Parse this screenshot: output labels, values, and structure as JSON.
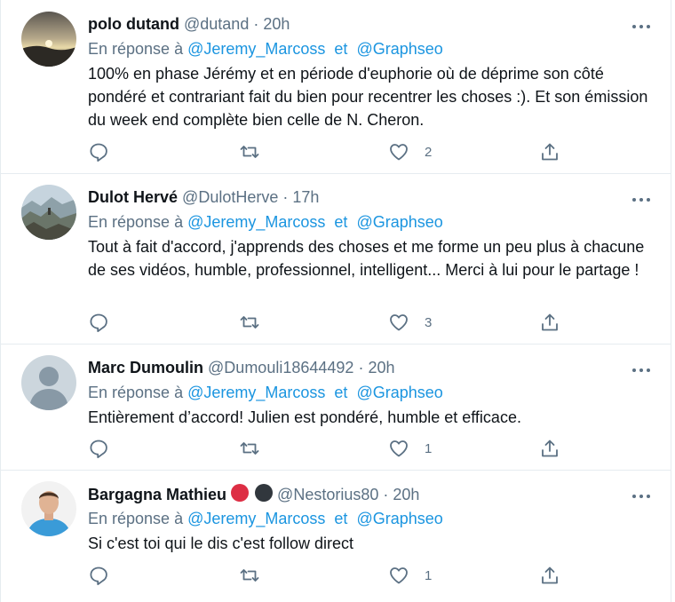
{
  "tweets": [
    {
      "name": "polo dutand",
      "handle": "@dutand",
      "time": "20h",
      "reply_prefix": "En réponse à",
      "reply_to": [
        "@Jeremy_Marcoss",
        "@Graphseo"
      ],
      "reply_sep": "et",
      "text": "100% en phase Jérémy et en période d'euphorie où de déprime son côté pondéré et contrariant fait du bien pour recentrer les choses :). Et son émission du week end complète bien celle de N. Cheron.",
      "likes": "2"
    },
    {
      "name": "Dulot Hervé",
      "handle": "@DulotHerve",
      "time": "17h",
      "reply_prefix": "En réponse à",
      "reply_to": [
        "@Jeremy_Marcoss",
        "@Graphseo"
      ],
      "reply_sep": "et",
      "text": "Tout à fait d'accord, j'apprends des choses et me forme un peu plus à chacune de ses vidéos, humble, professionnel, intelligent... Merci à lui pour le partage !",
      "likes": "3"
    },
    {
      "name": "Marc Dumoulin",
      "handle": "@Dumouli18644492",
      "time": "20h",
      "reply_prefix": "En réponse à",
      "reply_to": [
        "@Jeremy_Marcoss",
        "@Graphseo"
      ],
      "reply_sep": "et",
      "text": "Entièrement d’accord! Julien est pondéré, humble et efficace.",
      "likes": "1"
    },
    {
      "name": "Bargagna Mathieu",
      "handle": "@Nestorius80",
      "time": "20h",
      "reply_prefix": "En réponse à",
      "reply_to": [
        "@Jeremy_Marcoss",
        "@Graphseo"
      ],
      "reply_sep": "et",
      "text": "Si c'est toi qui le dis c'est follow direct",
      "likes": "1",
      "badges": [
        "red-circle",
        "black-circle"
      ],
      "badge_colors": [
        "#dd2e44",
        "#31373d"
      ]
    }
  ],
  "colors": {
    "accent": "#1b95e0",
    "secondary_text": "#5b7083",
    "border": "#e6ecf0"
  },
  "icons": {
    "reply": "reply-icon",
    "retweet": "retweet-icon",
    "like": "heart-icon",
    "share": "share-icon",
    "more": "more-options-icon"
  }
}
